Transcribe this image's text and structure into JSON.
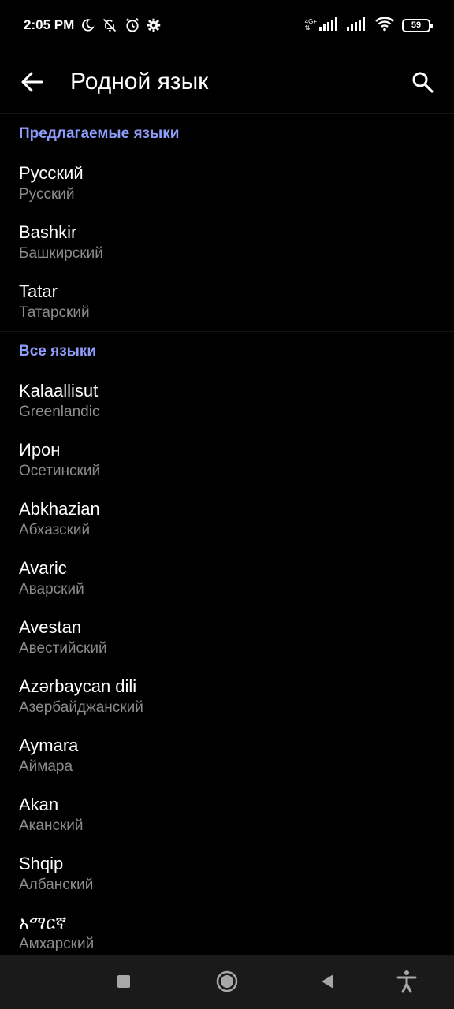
{
  "status_bar": {
    "time": "2:05 PM",
    "network_label_top": "4G+",
    "network_label_bottom": "⇅",
    "battery_level": "59",
    "icons": [
      "moon-icon",
      "mute-icon",
      "alarm-icon",
      "settings-gear-icon",
      "signal-icon",
      "signal-icon",
      "wifi-icon",
      "battery-icon"
    ]
  },
  "app_bar": {
    "title": "Родной язык",
    "back_icon": "arrow-left-icon",
    "search_icon": "search-icon"
  },
  "suggested": {
    "header": "Предлагаемые языки",
    "items": [
      {
        "name": "Русский",
        "sub": "Русский"
      },
      {
        "name": "Bashkir",
        "sub": "Башкирский"
      },
      {
        "name": "Tatar",
        "sub": "Татарский"
      }
    ]
  },
  "all": {
    "header": "Все языки",
    "items": [
      {
        "name": "Kalaallisut",
        "sub": "Greenlandic"
      },
      {
        "name": "Ирон",
        "sub": "Осетинский"
      },
      {
        "name": "Abkhazian",
        "sub": "Абхазский"
      },
      {
        "name": "Avaric",
        "sub": "Аварский"
      },
      {
        "name": "Avestan",
        "sub": "Авестийский"
      },
      {
        "name": "Azərbaycan dili",
        "sub": "Азербайджанский"
      },
      {
        "name": "Aymara",
        "sub": "Аймара"
      },
      {
        "name": "Akan",
        "sub": "Аканский"
      },
      {
        "name": "Shqip",
        "sub": "Албанский"
      },
      {
        "name": "አማርኛ",
        "sub": "Амхарский"
      }
    ]
  },
  "colors": {
    "background": "#000000",
    "accent": "#8e9dfa",
    "secondary_text": "#8c8c8c",
    "nav_bar": "#1a1a1a"
  },
  "nav_bar": {
    "icons": [
      "recents-square-icon",
      "home-circle-icon",
      "back-triangle-icon",
      "accessibility-icon"
    ]
  }
}
